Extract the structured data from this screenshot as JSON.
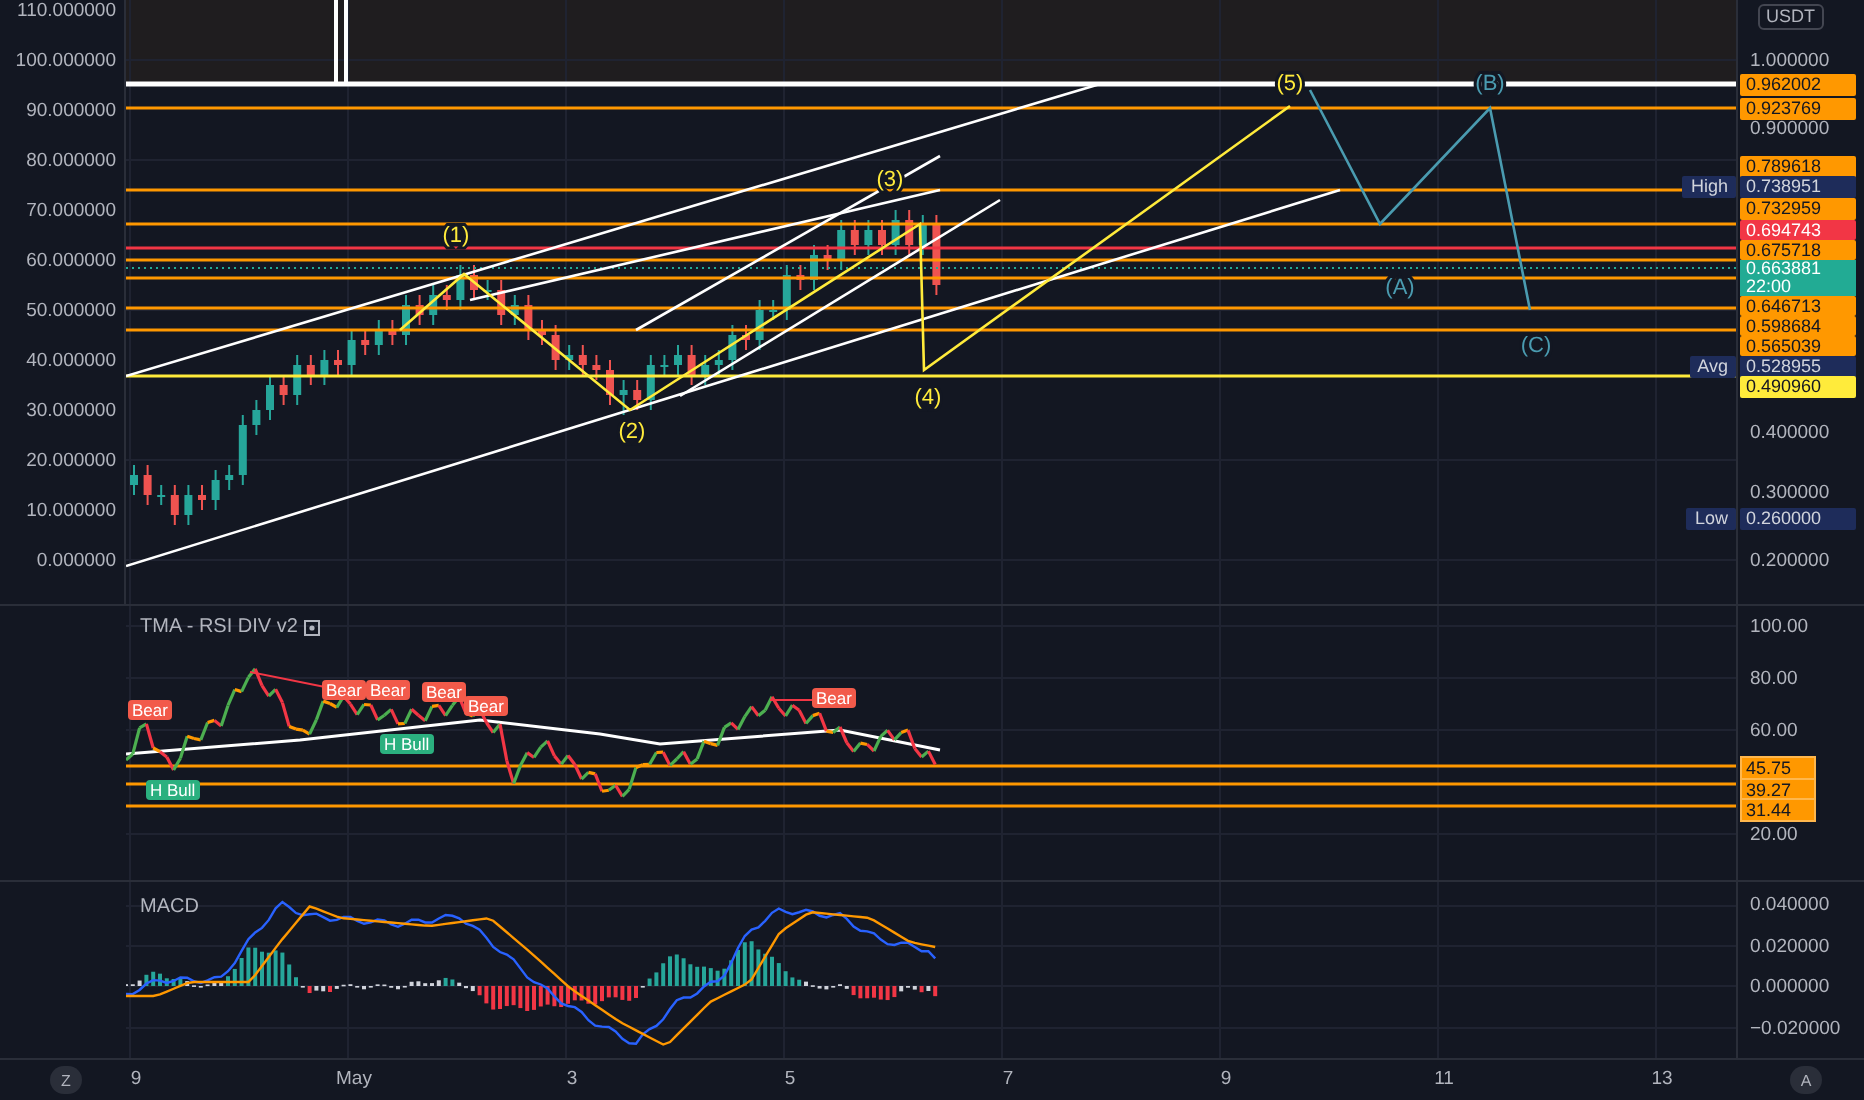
{
  "main_pane": {
    "currency": "USDT",
    "right_axis": [
      {
        "kind": "plain",
        "text": "1.000000"
      },
      {
        "kind": "orange",
        "text": "0.962002"
      },
      {
        "kind": "orange",
        "text": "0.923769"
      },
      {
        "kind": "plain",
        "text": "0.900000"
      },
      {
        "kind": "orange",
        "text": "0.789618"
      },
      {
        "kind": "marker",
        "marker": "High",
        "text": "0.738951"
      },
      {
        "kind": "orange",
        "text": "0.732959"
      },
      {
        "kind": "red",
        "text": "0.694743"
      },
      {
        "kind": "orange",
        "text": "0.675718"
      },
      {
        "kind": "price",
        "text": "0.663881",
        "countdown": "22:00"
      },
      {
        "kind": "orange",
        "text": "0.646713"
      },
      {
        "kind": "orange",
        "text": "0.598684"
      },
      {
        "kind": "orange",
        "text": "0.565039"
      },
      {
        "kind": "marker",
        "marker": "Avg",
        "text": "0.528955"
      },
      {
        "kind": "yellow",
        "text": "0.490960"
      },
      {
        "kind": "plain",
        "text": "0.400000"
      },
      {
        "kind": "plain",
        "text": "0.300000"
      },
      {
        "kind": "marker",
        "marker": "Low",
        "text": "0.260000"
      },
      {
        "kind": "plain",
        "text": "0.200000"
      }
    ],
    "chart_data": {
      "type": "candlestick",
      "ylim": [
        -8.8,
        112
      ],
      "grid": true,
      "yticks": [
        {
          "value": 110,
          "label": "110.000000"
        },
        {
          "value": 100,
          "label": "100.000000"
        },
        {
          "value": 90,
          "label": "90.000000"
        },
        {
          "value": 80,
          "label": "80.000000"
        },
        {
          "value": 70,
          "label": "70.000000"
        },
        {
          "value": 60,
          "label": "60.000000"
        },
        {
          "value": 50,
          "label": "50.000000"
        },
        {
          "value": 40,
          "label": "40.000000"
        },
        {
          "value": 30,
          "label": "30.000000"
        },
        {
          "value": 20,
          "label": "20.000000"
        },
        {
          "value": 10,
          "label": "10.000000"
        },
        {
          "value": 0,
          "label": "0.000000"
        }
      ],
      "categories": [
        null,
        null,
        null,
        null,
        null,
        null,
        null,
        null,
        null,
        null,
        null,
        null,
        null,
        null,
        null,
        null,
        null,
        null,
        null,
        null,
        null,
        null,
        null,
        null,
        null,
        null,
        null,
        null,
        null,
        null,
        null,
        null,
        null,
        null,
        null,
        null,
        null,
        null,
        null,
        null,
        null,
        null,
        null,
        null,
        null,
        null,
        null,
        null,
        null,
        null,
        null,
        null,
        null,
        null,
        null,
        null,
        null,
        null,
        null,
        null
      ],
      "ohlc": [
        [
          15,
          19,
          13,
          17
        ],
        [
          17,
          19,
          11,
          13
        ],
        [
          13,
          15,
          11,
          13
        ],
        [
          13,
          15,
          7,
          9
        ],
        [
          9,
          15,
          7,
          13
        ],
        [
          13,
          15,
          10,
          12
        ],
        [
          12,
          18,
          10,
          16
        ],
        [
          16,
          19,
          14,
          17
        ],
        [
          17,
          29,
          15,
          27
        ],
        [
          27,
          32,
          25,
          30
        ],
        [
          30,
          37,
          28,
          35
        ],
        [
          35,
          37,
          31,
          33
        ],
        [
          33,
          41,
          31,
          39
        ],
        [
          39,
          41,
          35,
          37
        ],
        [
          37,
          42,
          35,
          40
        ],
        [
          40,
          42,
          37,
          39
        ],
        [
          39,
          46,
          37,
          44
        ],
        [
          44,
          46,
          41,
          43
        ],
        [
          43,
          48,
          41,
          46
        ],
        [
          46,
          48,
          43,
          45
        ],
        [
          45,
          53,
          43,
          51
        ],
        [
          51,
          53,
          47,
          49
        ],
        [
          49,
          55,
          47,
          53
        ],
        [
          53,
          55,
          50,
          52
        ],
        [
          52,
          59,
          50,
          57
        ],
        [
          57,
          59,
          52,
          54
        ],
        [
          54,
          56,
          52,
          54
        ],
        [
          54,
          56,
          47,
          49
        ],
        [
          49,
          53,
          47,
          51
        ],
        [
          51,
          53,
          44,
          46
        ],
        [
          46,
          48,
          43,
          45
        ],
        [
          45,
          47,
          38,
          40
        ],
        [
          40,
          43,
          38,
          41
        ],
        [
          41,
          43,
          37,
          39
        ],
        [
          39,
          41,
          36,
          38
        ],
        [
          38,
          40,
          31,
          33
        ],
        [
          33,
          36,
          29,
          34
        ],
        [
          34,
          36,
          30,
          32
        ],
        [
          32,
          41,
          30,
          39
        ],
        [
          39,
          41,
          37,
          39
        ],
        [
          39,
          43,
          37,
          41
        ],
        [
          41,
          43,
          35,
          37
        ],
        [
          37,
          41,
          35,
          39
        ],
        [
          39,
          42,
          37,
          40
        ],
        [
          40,
          47,
          38,
          45
        ],
        [
          45,
          47,
          42,
          44
        ],
        [
          44,
          52,
          42,
          50
        ],
        [
          50,
          52,
          48,
          50
        ],
        [
          50,
          59,
          48,
          57
        ],
        [
          57,
          59,
          54,
          56
        ],
        [
          56,
          63,
          54,
          61
        ],
        [
          61,
          63,
          58,
          60
        ],
        [
          60,
          68,
          58,
          66
        ],
        [
          66,
          68,
          61,
          63
        ],
        [
          63,
          68,
          61,
          66
        ],
        [
          66,
          68,
          61,
          63
        ],
        [
          63,
          70,
          61,
          68
        ],
        [
          68,
          70,
          61,
          63
        ],
        [
          63,
          69,
          61,
          67
        ],
        [
          67,
          69,
          53,
          55
        ]
      ]
    },
    "wave_labels": [
      "(1)",
      "(2)",
      "(3)",
      "(4)",
      "(5)"
    ],
    "correction_labels": [
      "(A)",
      "(B)",
      "(C)"
    ]
  },
  "rsi_pane": {
    "title": "TMA - RSI DIV v2",
    "axis": [
      "100.00",
      "80.00",
      "60.00",
      "20.00"
    ],
    "level_tags": [
      "45.75",
      "39.27",
      "31.44"
    ],
    "signals": [
      {
        "kind": "bear",
        "text": "Bear"
      },
      {
        "kind": "bear",
        "text": "Bear"
      },
      {
        "kind": "bear",
        "text": "Bear"
      },
      {
        "kind": "bear",
        "text": "Bear"
      },
      {
        "kind": "bear",
        "text": "Bear"
      },
      {
        "kind": "bull",
        "text": "H Bull"
      },
      {
        "kind": "bull",
        "text": "H Bull"
      },
      {
        "kind": "bear",
        "text": "Bear"
      }
    ]
  },
  "macd_pane": {
    "title": "MACD",
    "axis": [
      "0.040000",
      "0.020000",
      "0.000000",
      "−0.020000"
    ]
  },
  "time_axis": {
    "labels": [
      "9",
      "May",
      "3",
      "5",
      "7",
      "9",
      "11",
      "13"
    ],
    "left_button": "Z",
    "right_button": "A"
  }
}
